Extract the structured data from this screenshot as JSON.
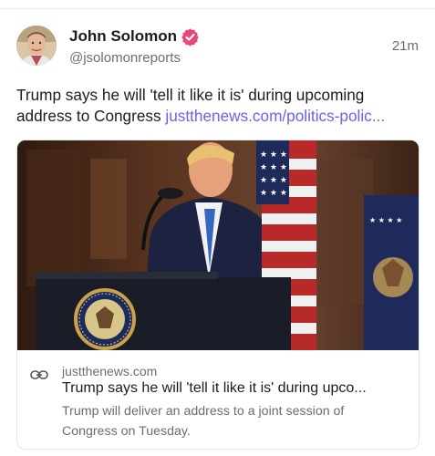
{
  "post": {
    "author_name": "John Solomon",
    "handle": "@jsolomonreports",
    "time": "21m",
    "text": "Trump says he will 'tell it like it is' during upcoming address to Congress ",
    "link_text": "justthenews.com/politics-polic..."
  },
  "card": {
    "domain": "justthenews.com",
    "title": "Trump says he will 'tell it like it is' during upco...",
    "description": "Trump will deliver an address to a joint session of Congress on Tuesday.",
    "image_alt": "Trump speaking at a podium with the presidential seal and American flag"
  },
  "colors": {
    "verified_badge": "#e8477a",
    "link": "#6565ee",
    "muted_text": "#6d6d6d"
  },
  "icons": {
    "verified": "verified-badge-icon",
    "link": "link-icon"
  }
}
